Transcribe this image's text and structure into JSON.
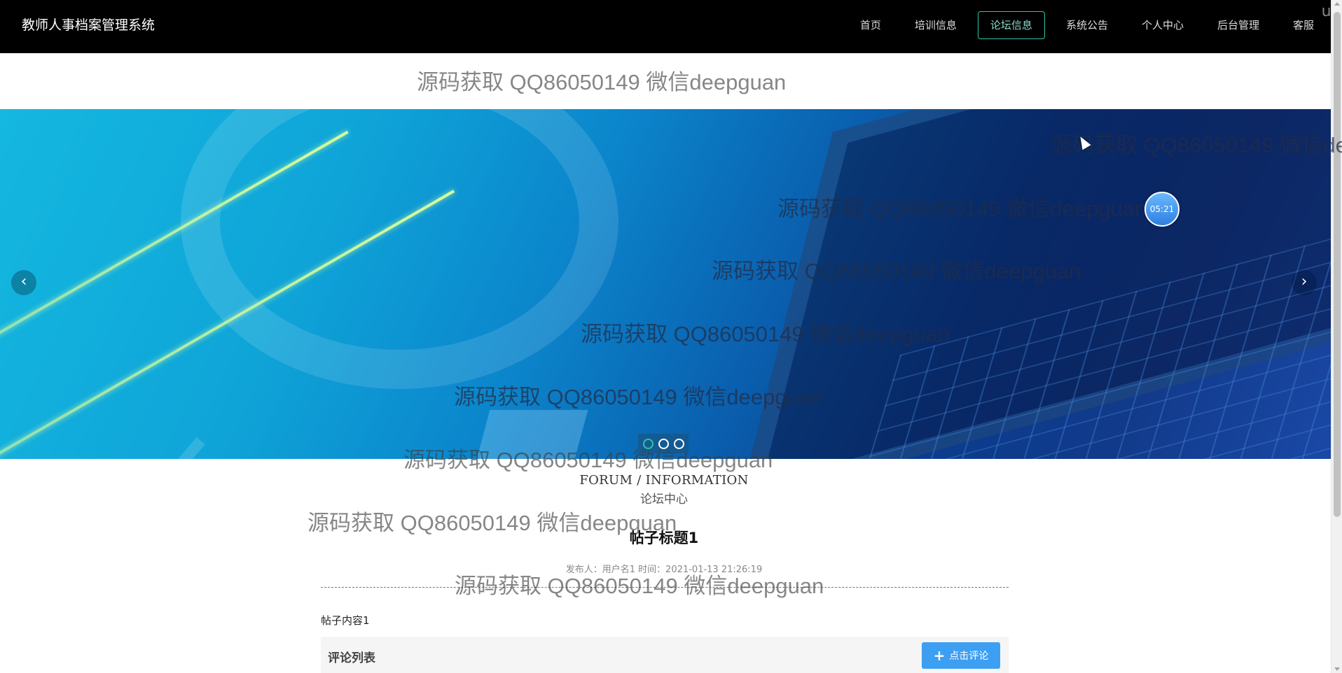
{
  "header": {
    "brand": "教师人事档案管理系统",
    "nav": [
      {
        "label": "首页",
        "active": false
      },
      {
        "label": "培训信息",
        "active": false
      },
      {
        "label": "论坛信息",
        "active": true
      },
      {
        "label": "系统公告",
        "active": false
      },
      {
        "label": "个人中心",
        "active": false
      },
      {
        "label": "后台管理",
        "active": false
      },
      {
        "label": "客服",
        "active": false
      }
    ],
    "corner_fragment": "ua"
  },
  "watermark": {
    "text": "源码获取 QQ86050149 微信deepguan"
  },
  "banner": {
    "prev_icon": "chevron-left-icon",
    "next_icon": "chevron-right-icon",
    "prev_glyph": "‹",
    "next_glyph": "›",
    "slide_count": 3,
    "active_slide": 1,
    "timer": "05:21"
  },
  "section": {
    "title_en": "FORUM / INFORMATION",
    "title_cn": "论坛中心"
  },
  "post": {
    "title": "帖子标题1",
    "meta": "发布人：用户名1 时间：2021-01-13 21:26:19",
    "content": "帖子内容1"
  },
  "comments": {
    "label": "评论列表",
    "button_label": "点击评论",
    "button_icon": "plus-icon"
  },
  "colors": {
    "accent": "#2ec4a6",
    "button": "#3d9ff2",
    "header_bg": "#000000"
  }
}
